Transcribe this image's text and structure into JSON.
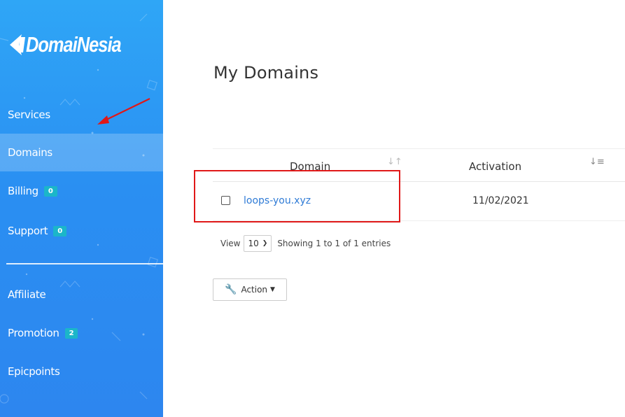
{
  "brand": {
    "logo_text": "DomaiNesia"
  },
  "sidebar": {
    "items": [
      {
        "label": "Services"
      },
      {
        "label": "Domains",
        "active": true
      },
      {
        "label": "Billing",
        "badge": "0"
      },
      {
        "label": "Support",
        "badge": "0"
      },
      {
        "label": "Affiliate"
      },
      {
        "label": "Promotion",
        "badge": "2"
      },
      {
        "label": "Epicpoints"
      }
    ]
  },
  "main": {
    "title": "My Domains",
    "table": {
      "columns": [
        {
          "label": "Domain"
        },
        {
          "label": "Activation"
        }
      ],
      "rows": [
        {
          "domain": "loops-you.xyz",
          "activation": "11/02/2021"
        }
      ]
    },
    "view_label": "View",
    "page_size": "10",
    "showing_text": "Showing 1 to 1 of 1 entries",
    "action_label": "Action"
  },
  "colors": {
    "sidebar_top": "#2fa6f6",
    "sidebar_bottom": "#2d86ef",
    "badge": "#1bb6c9",
    "link": "#2f7bd6",
    "annotation": "#e01818"
  }
}
